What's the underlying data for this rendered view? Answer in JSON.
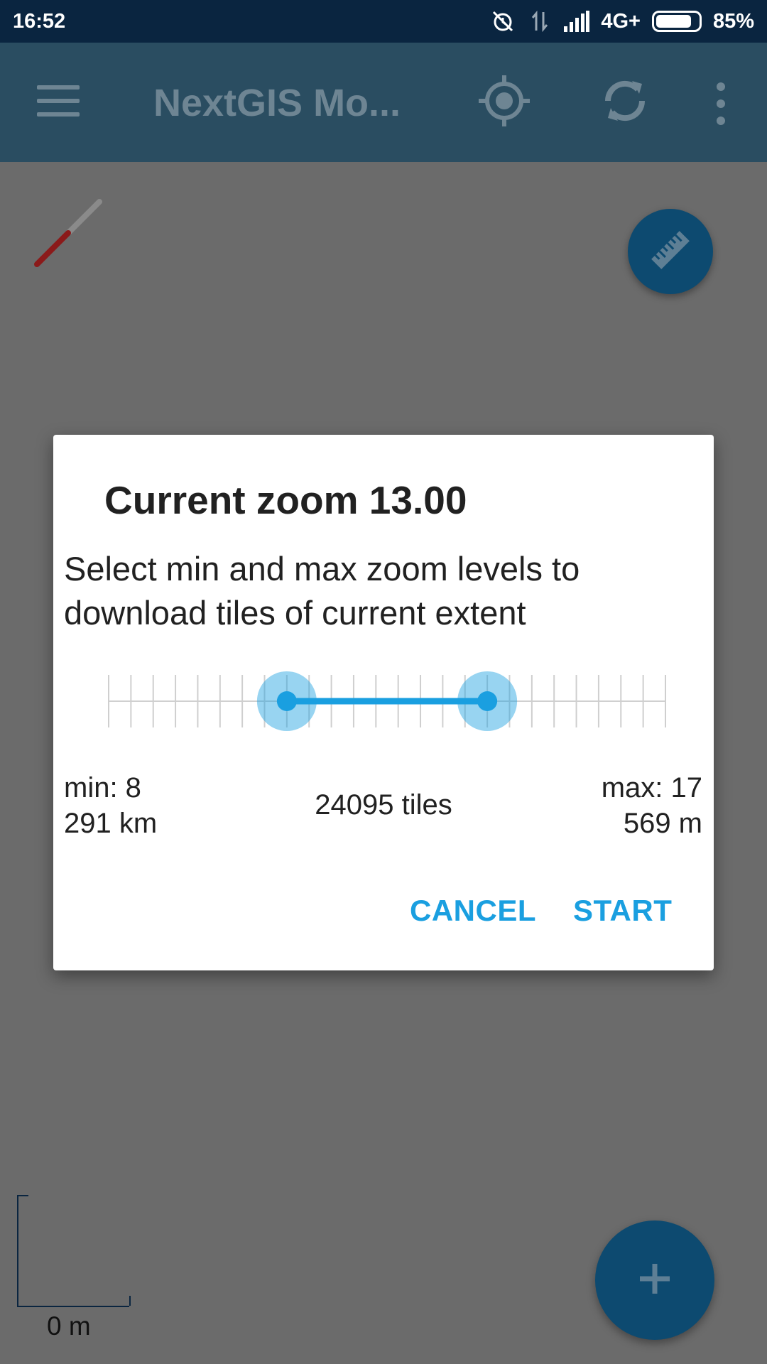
{
  "status_bar": {
    "time": "16:52",
    "network": "4G+",
    "battery_percent": "85%",
    "battery_level": 0.85,
    "icons": [
      "alarm-off-icon",
      "data-transfer-icon",
      "signal-icon",
      "battery-icon"
    ]
  },
  "app_bar": {
    "title": "NextGIS Mo...",
    "icons": [
      "menu-icon",
      "locate-icon",
      "sync-icon",
      "more-vert-icon"
    ]
  },
  "map": {
    "scale_label": "0 m",
    "fab_icons": [
      "ruler-icon",
      "add-icon"
    ]
  },
  "dialog": {
    "title": "Current zoom 13.00",
    "message": "Select min and max zoom levels to download tiles of current extent",
    "min_label": "min: 8",
    "min_distance": "291 km",
    "max_label": "max: 17",
    "max_distance": "569 m",
    "tiles_label": "24095 tiles",
    "cancel_label": "CANCEL",
    "start_label": "START",
    "slider": {
      "ticks": 26,
      "selected_min_index": 8,
      "selected_max_index": 17
    },
    "accent_color": "#1a9fe0"
  }
}
